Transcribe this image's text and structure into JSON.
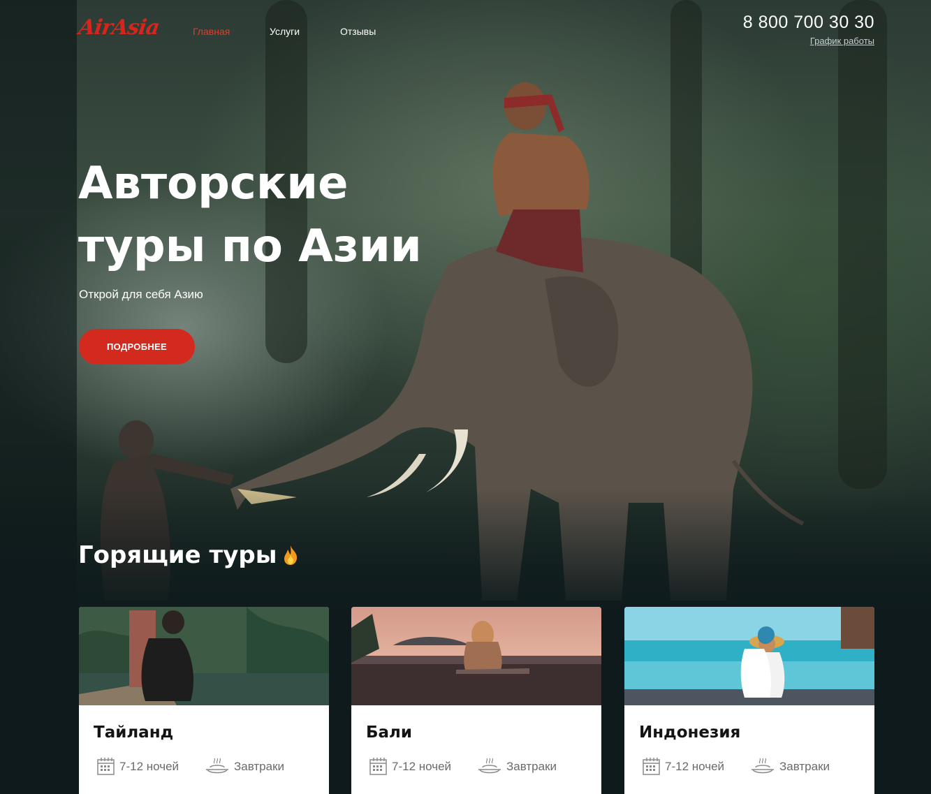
{
  "header": {
    "logo": "AirAsia",
    "nav": [
      {
        "label": "Главная",
        "active": true
      },
      {
        "label": "Услуги",
        "active": false
      },
      {
        "label": "Отзывы",
        "active": false
      }
    ],
    "phone": "8 800 700 30 30",
    "schedule_link": "График работы"
  },
  "hero": {
    "title_line1": "Авторские",
    "title_line2": "туры по Азии",
    "subtitle": "Открой для себя Азию",
    "cta_label": "ПОДРОБНЕЕ"
  },
  "hot_tours": {
    "title": "Горящие туры",
    "title_icon": "fire-icon",
    "cards": [
      {
        "title": "Тайланд",
        "nights": "7-12 ночей",
        "meals": "Завтраки"
      },
      {
        "title": "Бали",
        "nights": "7-12 ночей",
        "meals": "Завтраки"
      },
      {
        "title": "Индонезия",
        "nights": "7-12 ночей",
        "meals": "Завтраки"
      }
    ]
  },
  "colors": {
    "accent": "#d32a1f",
    "nav_active": "#e8392a",
    "background": "#0e1a1c"
  }
}
